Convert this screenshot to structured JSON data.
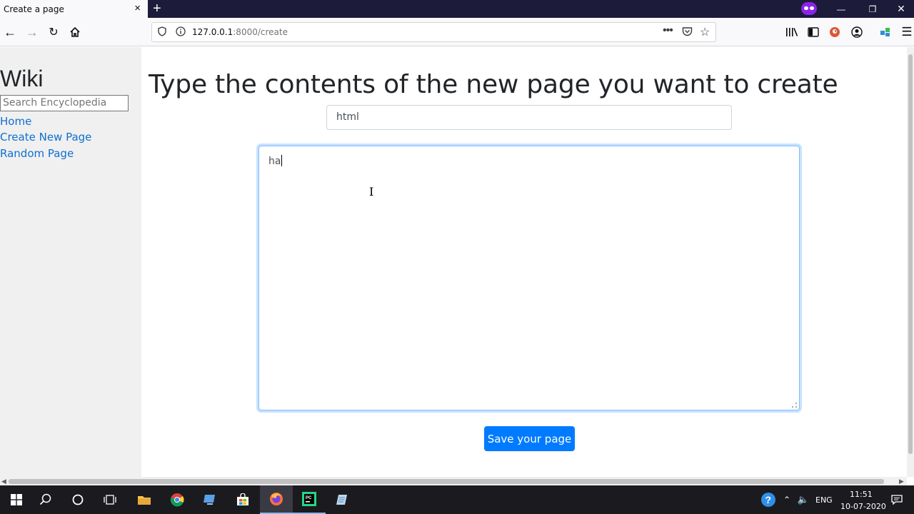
{
  "browser": {
    "tab_title": "Create a page",
    "tab_close_icon": "×",
    "new_tab_icon": "+",
    "url_host": "127.0.0.1",
    "url_rest": ":8000/create",
    "colors": {
      "tabbar": "#1c1b3a",
      "private_badge": "#8a25e8"
    }
  },
  "sidebar": {
    "logo": "Wiki",
    "search_placeholder": "Search Encyclopedia",
    "links": [
      "Home",
      "Create New Page",
      "Random Page"
    ]
  },
  "main": {
    "heading": "Type the contents of the new page you want to create",
    "title_value": "html",
    "content_value": "ha",
    "save_label": "Save your page",
    "colors": {
      "link": "#0f6fd1",
      "primary_button": "#007bff"
    }
  },
  "taskbar": {
    "language": "ENG",
    "time": "11:51",
    "date": "10-07-2020"
  }
}
